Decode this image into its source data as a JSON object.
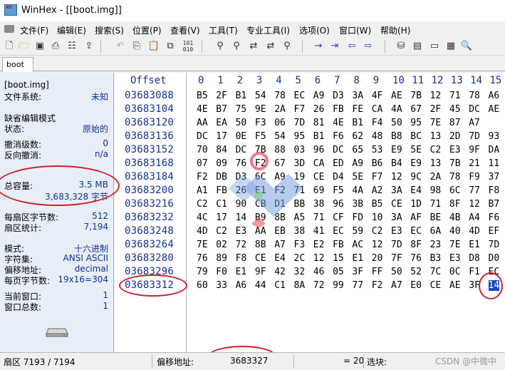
{
  "window": {
    "title": "WinHex - [[boot.img]]",
    "app_icon_text": "HEX"
  },
  "menu": [
    {
      "label": "文件(F)"
    },
    {
      "label": "编辑(E)"
    },
    {
      "label": "搜索(S)"
    },
    {
      "label": "位置(P)"
    },
    {
      "label": "查看(V)"
    },
    {
      "label": "工具(T)"
    },
    {
      "label": "专业工具(I)"
    },
    {
      "label": "选项(O)"
    },
    {
      "label": "窗口(W)"
    },
    {
      "label": "帮助(H)"
    }
  ],
  "toolbar": {
    "icons": [
      "new-file-icon",
      "open-folder-icon",
      "save-icon",
      "print-icon",
      "properties-icon",
      "export-icon",
      "undo-icon",
      "copy-icon",
      "paste-icon",
      "paste-special-icon",
      "binary-icon",
      "find-icon",
      "find-hex-icon",
      "replace-icon",
      "replace-hex-icon",
      "find-next-icon",
      "goto-offset-icon",
      "goto-end-icon",
      "back-icon",
      "forward-icon",
      "disk-editor-icon",
      "ram-editor-icon",
      "drive-icon",
      "calculator-icon",
      "search-zoom-icon"
    ]
  },
  "tab": {
    "label": "boot"
  },
  "info_panel": {
    "file_name": "[boot.img]",
    "filesystem_label": "文件系统:",
    "filesystem_value": "未知",
    "default_edit_mode": "缺省编辑模式",
    "state_label": "状态:",
    "state_value": "原始的",
    "undo_level_label": "撤消级数:",
    "undo_level_value": "0",
    "reverse_undo_label": "反向撤消:",
    "reverse_undo_value": "n/a",
    "total_capacity_label": "总容量:",
    "total_capacity_value": "3.5 MB",
    "total_capacity_bytes": "3,683,328 字节",
    "bytes_per_sector_label": "每扇区字节数:",
    "bytes_per_sector_value": "512",
    "sector_count_label": "扇区统计:",
    "sector_count_value": "7,194",
    "mode_label": "模式:",
    "mode_value": "十六进制",
    "charset_label": "字符集:",
    "charset_value": "ANSI ASCII",
    "offset_label": "偏移地址:",
    "offset_value": "decimal",
    "bytes_per_page_label": "每页字节数:",
    "bytes_per_page_value": "19x16=304",
    "current_window_label": "当前窗口:",
    "current_window_value": "1",
    "window_total_label": "窗口总数:",
    "window_total_value": "1"
  },
  "hex_view": {
    "offset_header": "Offset",
    "columns": [
      "0",
      "1",
      "2",
      "3",
      "4",
      "5",
      "6",
      "7",
      "8",
      "9",
      "10",
      "11",
      "12",
      "13",
      "14",
      "15"
    ],
    "rows": [
      {
        "offset": "03683088",
        "bytes": [
          "B5",
          "2F",
          "B1",
          "54",
          "78",
          "EC",
          "A9",
          "D3",
          "3A",
          "4F",
          "AE",
          "7B",
          "12",
          "71",
          "78",
          "A6"
        ]
      },
      {
        "offset": "03683104",
        "bytes": [
          "4E",
          "B7",
          "75",
          "9E",
          "2A",
          "F7",
          "26",
          "FB",
          "FE",
          "CA",
          "4A",
          "67",
          "2F",
          "45",
          "DC",
          "AE"
        ]
      },
      {
        "offset": "03683120",
        "bytes": [
          "AA",
          "EA",
          "50",
          "F3",
          "06",
          "7D",
          "81",
          "4E",
          "B1",
          "F4",
          "50",
          "95",
          "7E",
          "87",
          "A7"
        ]
      },
      {
        "offset": "03683136",
        "bytes": [
          "DC",
          "17",
          "0E",
          "F5",
          "54",
          "95",
          "B1",
          "F6",
          "62",
          "48",
          "B8",
          "BC",
          "13",
          "2D",
          "7D",
          "93"
        ]
      },
      {
        "offset": "03683152",
        "bytes": [
          "70",
          "84",
          "DC",
          "7B",
          "88",
          "03",
          "96",
          "DC",
          "65",
          "53",
          "E9",
          "5E",
          "C2",
          "E3",
          "9F",
          "DA"
        ]
      },
      {
        "offset": "03683168",
        "bytes": [
          "07",
          "09",
          "76",
          "F2",
          "67",
          "3D",
          "CA",
          "ED",
          "A9",
          "B6",
          "B4",
          "E9",
          "13",
          "7B",
          "21",
          "11"
        ]
      },
      {
        "offset": "03683184",
        "bytes": [
          "F2",
          "DB",
          "D3",
          "6C",
          "A9",
          "19",
          "CE",
          "D4",
          "5E",
          "F7",
          "12",
          "9C",
          "2A",
          "78",
          "F9",
          "37"
        ]
      },
      {
        "offset": "03683200",
        "bytes": [
          "A1",
          "FB",
          "26",
          "E1",
          "F2",
          "71",
          "69",
          "F5",
          "4A",
          "A2",
          "3A",
          "E4",
          "98",
          "6C",
          "77",
          "F8"
        ]
      },
      {
        "offset": "03683216",
        "bytes": [
          "C2",
          "C1",
          "90",
          "CB",
          "D1",
          "BB",
          "38",
          "96",
          "3B",
          "B5",
          "CE",
          "1D",
          "71",
          "8F",
          "12",
          "B7"
        ]
      },
      {
        "offset": "03683232",
        "bytes": [
          "4C",
          "17",
          "14",
          "B9",
          "8B",
          "A5",
          "71",
          "CF",
          "FD",
          "10",
          "3A",
          "AF",
          "BE",
          "4B",
          "A4",
          "F6"
        ]
      },
      {
        "offset": "03683248",
        "bytes": [
          "4D",
          "C2",
          "E3",
          "AA",
          "EB",
          "38",
          "41",
          "EC",
          "59",
          "C2",
          "E3",
          "EC",
          "6A",
          "40",
          "4D",
          "EF"
        ]
      },
      {
        "offset": "03683264",
        "bytes": [
          "7E",
          "02",
          "72",
          "8B",
          "A7",
          "F3",
          "E2",
          "FB",
          "AC",
          "12",
          "7D",
          "8F",
          "23",
          "7E",
          "E1",
          "7D"
        ]
      },
      {
        "offset": "03683280",
        "bytes": [
          "76",
          "89",
          "F8",
          "CE",
          "E4",
          "2C",
          "12",
          "15",
          "E1",
          "20",
          "7F",
          "76",
          "B3",
          "E3",
          "D8",
          "D0"
        ]
      },
      {
        "offset": "03683296",
        "bytes": [
          "79",
          "F0",
          "E1",
          "9F",
          "42",
          "32",
          "46",
          "05",
          "3F",
          "FF",
          "50",
          "52",
          "7C",
          "0C",
          "F1",
          "EC"
        ]
      },
      {
        "offset": "03683312",
        "bytes": [
          "60",
          "33",
          "A6",
          "44",
          "C1",
          "8A",
          "72",
          "99",
          "77",
          "F2",
          "A7",
          "E0",
          "CE",
          "AE",
          "3F",
          "14"
        ]
      }
    ]
  },
  "status_bar": {
    "sector": "扇区 7193 / 7194",
    "offset_label": "偏移地址:",
    "offset_value": "3683327",
    "value": "= 20",
    "block_label": "选块:",
    "credit": "CSDN @中微中"
  }
}
